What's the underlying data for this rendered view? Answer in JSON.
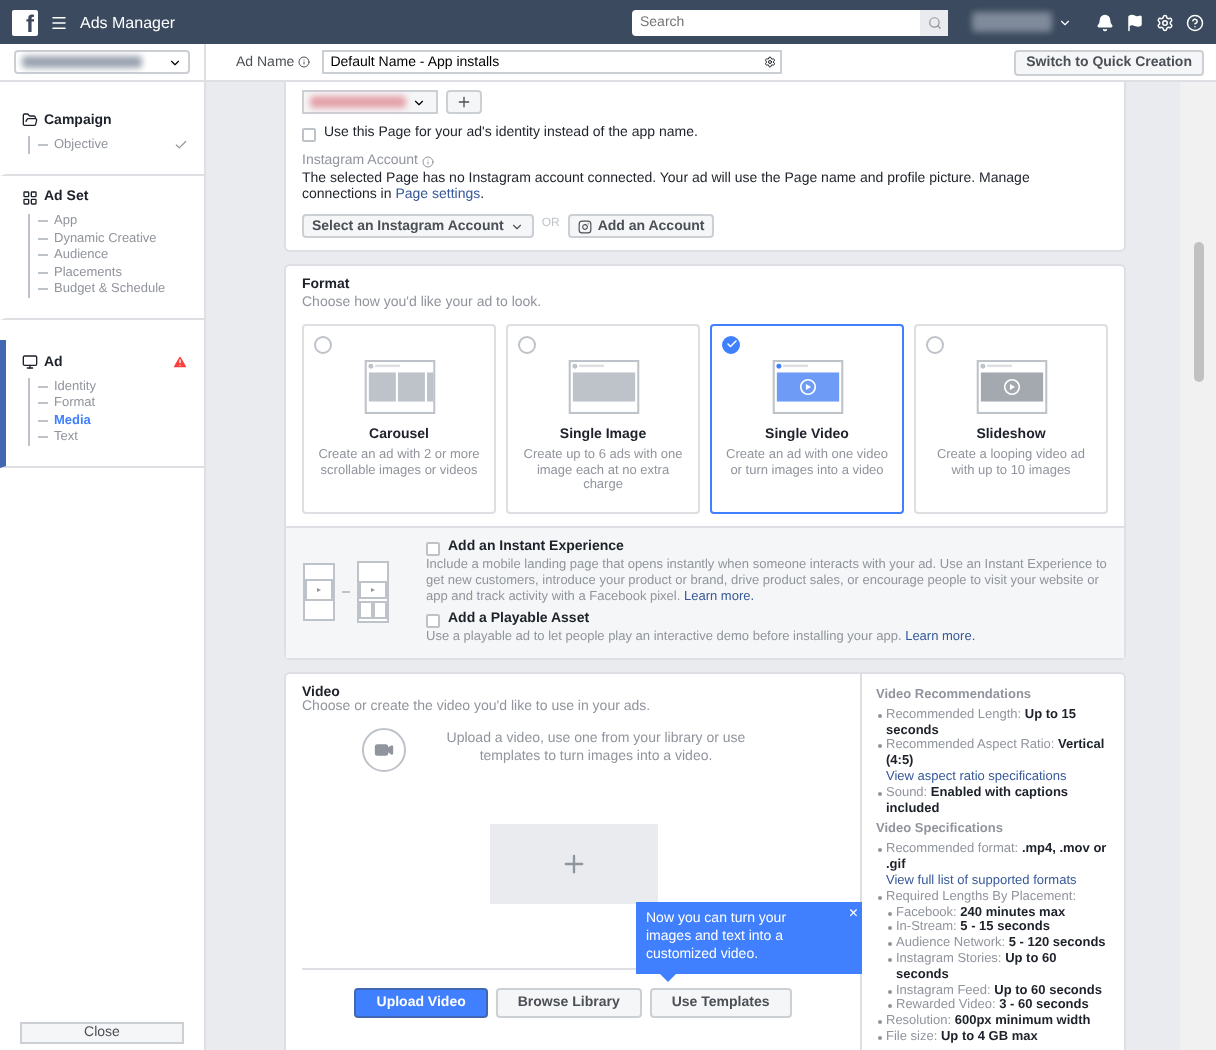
{
  "topbar": {
    "logo": "f",
    "app_title": "Ads Manager",
    "search": {
      "placeholder": "Search"
    }
  },
  "header": {
    "ad_name_label": "Ad Name",
    "ad_name_value": "Default Name - App installs",
    "quick_creation_button": "Switch to Quick Creation"
  },
  "sidebar": {
    "sections": [
      {
        "title": "Campaign",
        "kind": "campaign",
        "warning": false,
        "selected": false,
        "items": [
          {
            "label": "Objective",
            "done": true,
            "selected": false
          }
        ]
      },
      {
        "title": "Ad Set",
        "kind": "adset",
        "warning": false,
        "selected": false,
        "items": [
          {
            "label": "App",
            "done": false,
            "selected": false
          },
          {
            "label": "Dynamic Creative",
            "done": false,
            "selected": false
          },
          {
            "label": "Audience",
            "done": false,
            "selected": false
          },
          {
            "label": "Placements",
            "done": false,
            "selected": false
          },
          {
            "label": "Budget & Schedule",
            "done": false,
            "selected": false
          }
        ]
      },
      {
        "title": "Ad",
        "kind": "ad",
        "warning": true,
        "selected": true,
        "items": [
          {
            "label": "Identity",
            "done": false,
            "selected": false
          },
          {
            "label": "Format",
            "done": false,
            "selected": false
          },
          {
            "label": "Media",
            "done": false,
            "selected": true
          },
          {
            "label": "Text",
            "done": false,
            "selected": false
          }
        ]
      }
    ],
    "close_button": "Close"
  },
  "identity": {
    "page_identity": {
      "label": "Use this Page for your ad's identity instead of the app name.",
      "checked": false
    },
    "instagram_label": "Instagram Account",
    "instagram_text": "The selected Page has no Instagram account connected. Your ad will use the Page name and profile picture. Manage connections in",
    "instagram_link": "Page settings",
    "instagram_link_suffix": ".",
    "select_button": "Select an Instagram Account",
    "or": "OR",
    "add_button": "Add an Account"
  },
  "format": {
    "title": "Format",
    "subtitle": "Choose how you'd like your ad to look.",
    "options": [
      {
        "kind": "carousel",
        "title": "Carousel",
        "description": "Create an ad with 2 or more scrollable images or videos",
        "selected": false
      },
      {
        "kind": "image",
        "title": "Single Image",
        "description": "Create up to 6 ads with one image each at no extra charge",
        "selected": false
      },
      {
        "kind": "video",
        "title": "Single Video",
        "description": "Create an ad with one video or turn images into a video",
        "selected": true
      },
      {
        "kind": "slideshow",
        "title": "Slideshow",
        "description": "Create a looping video ad with up to 10 images",
        "selected": false
      }
    ],
    "extras": [
      {
        "label": "Add an Instant Experience",
        "description": "Include a mobile landing page that opens instantly when someone interacts with your ad. Use an Instant Experience to get new customers, introduce your product or brand, drive product sales, or encourage people to visit your website or app and track activity with a Facebook pixel.",
        "link": "Learn more.",
        "checked": false
      },
      {
        "label": "Add a Playable Asset",
        "description": "Use a playable ad to let people play an interactive demo before installing your app.",
        "link": "Learn more.",
        "checked": false
      }
    ]
  },
  "video": {
    "title": "Video",
    "subtitle": "Choose or create the video you'd like to use in your ads.",
    "hint": "Upload a video, use one from your library or use templates to turn images into a video.",
    "buttons": [
      {
        "label": "Upload Video",
        "kind": "primary"
      },
      {
        "label": "Browse Library",
        "kind": "secondary"
      },
      {
        "label": "Use Templates",
        "kind": "secondary"
      }
    ],
    "tooltip": {
      "text": "Now you can turn your images and text into a customized video.",
      "close": "×"
    }
  },
  "specs": [
    {
      "title": "Video Recommendations",
      "items": [
        {
          "label": "Recommended Length:",
          "value": "Up to 15 seconds"
        },
        {
          "label": "Recommended Aspect Ratio:",
          "value": "Vertical (4:5)",
          "link": "View aspect ratio specifications"
        },
        {
          "label": "Sound:",
          "value": "Enabled with captions included"
        }
      ]
    },
    {
      "title": "Video Specifications",
      "items": [
        {
          "label": "Recommended format:",
          "value": ".mp4, .mov or .gif",
          "link": "View full list of supported formats"
        },
        {
          "label": "Required Lengths By Placement:",
          "children": [
            {
              "label": "Facebook:",
              "value": "240 minutes max"
            },
            {
              "label": "In-Stream:",
              "value": "5 - 15 seconds"
            },
            {
              "label": "Audience Network:",
              "value": "5 - 120 seconds"
            },
            {
              "label": "Instagram Stories:",
              "value": "Up to 60 seconds"
            },
            {
              "label": "Instagram Feed:",
              "value": "Up to 60 seconds"
            },
            {
              "label": "Rewarded Video:",
              "value": "3 - 60 seconds"
            }
          ]
        },
        {
          "label": "Resolution:",
          "value": "600px minimum width"
        },
        {
          "label": "File size:",
          "value": "Up to 4 GB max"
        }
      ]
    }
  ]
}
